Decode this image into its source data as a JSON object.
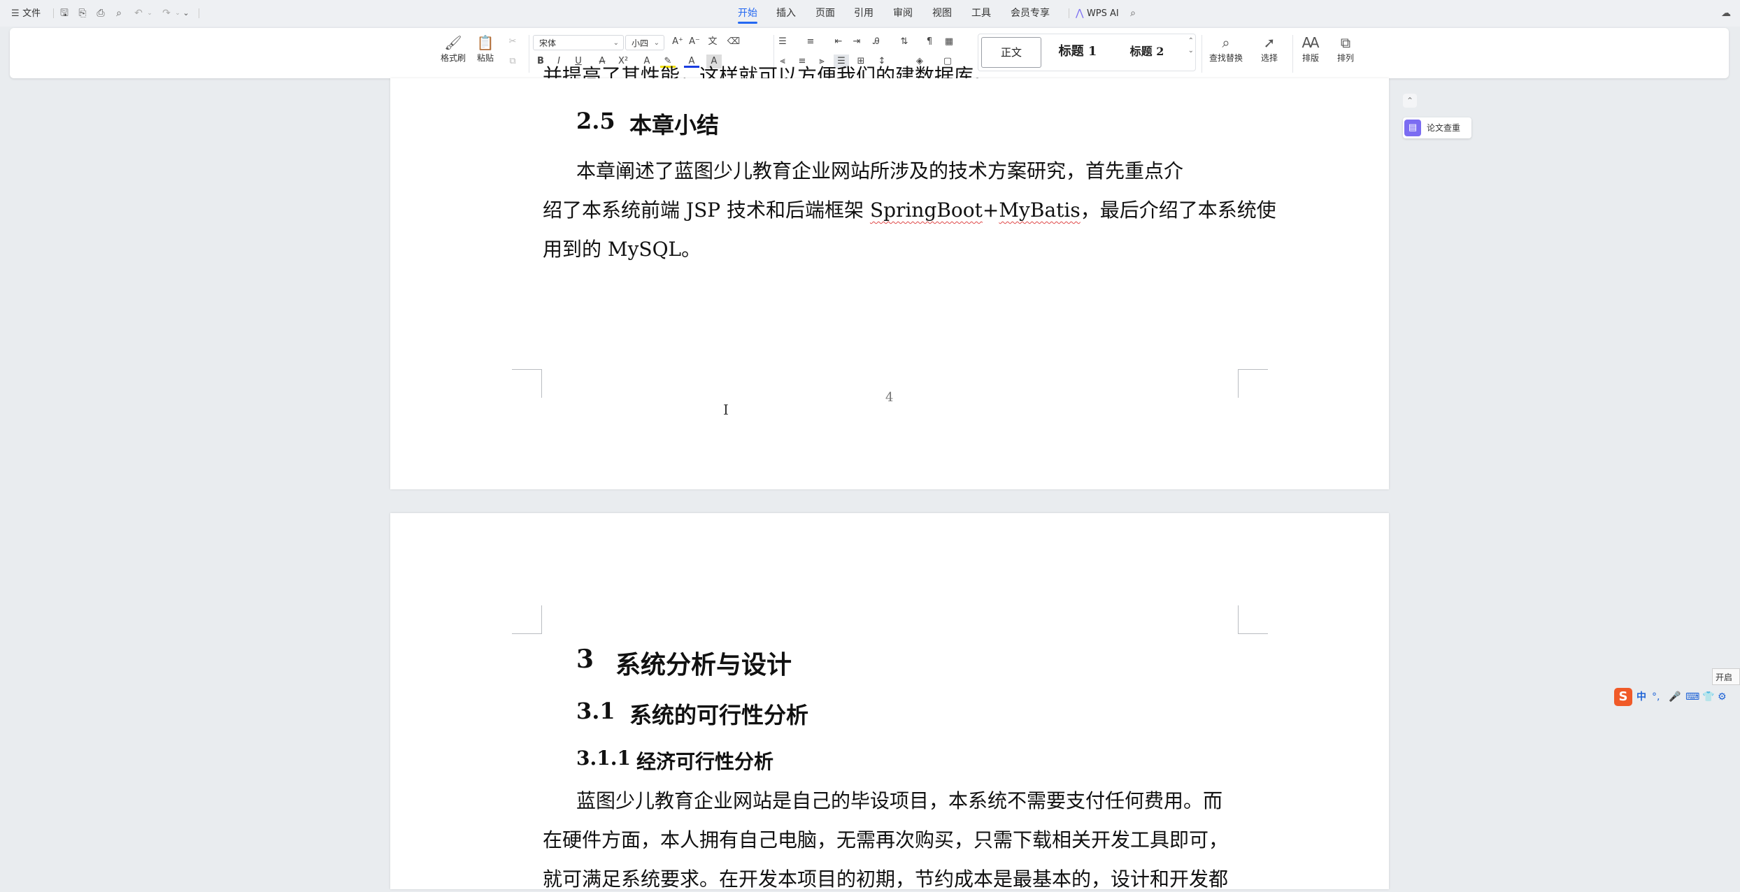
{
  "topbar": {
    "file_label": "文件",
    "tabs": [
      {
        "label": "开始",
        "active": true
      },
      {
        "label": "插入"
      },
      {
        "label": "页面"
      },
      {
        "label": "引用"
      },
      {
        "label": "审阅"
      },
      {
        "label": "视图"
      },
      {
        "label": "工具"
      },
      {
        "label": "会员专享"
      }
    ],
    "wps_ai": "WPS AI"
  },
  "ribbon": {
    "format_painter": "格式刷",
    "paste": "粘贴",
    "font_name": "宋体",
    "font_size": "小四",
    "styles": {
      "normal": "正文",
      "heading1": "标题 1",
      "heading2": "标题 2"
    },
    "find_replace": "查找替换",
    "select": "选择",
    "layout": "排版",
    "arrange": "排列"
  },
  "page1": {
    "cut_line": "并提高了其性能，这样就可以方便我们的建数据库。",
    "section_number": "2.5",
    "section_title": "本章小结",
    "para_line1": "本章阐述了蓝图少儿教育企业网站所涉及的技术方案研究，首先重点介",
    "para_line2_a": "绍了本系统前端 JSP 技术和后端框架 ",
    "para_line2_b": "SpringBoot",
    "para_line2_c": "+",
    "para_line2_d": "MyBatis",
    "para_line2_e": "，最后介绍了本系统使",
    "para_line3": "用到的 MySQL。",
    "page_number": "4"
  },
  "page2": {
    "chapter_number": "3",
    "chapter_title": "系统分析与设计",
    "section_number": "3.1",
    "section_title": "系统的可行性分析",
    "subsection_number": "3.1.1",
    "subsection_title": "经济可行性分析",
    "para_line1": "蓝图少儿教育企业网站是自己的毕设项目，本系统不需要支付任何费用。而",
    "para_line2": "在硬件方面，本人拥有自己电脑，无需再次购买，只需下载相关开发工具即可，",
    "para_line3": "就可满足系统要求。在开发本项目的初期，节约成本是最基本的，设计和开发都"
  },
  "side_panel": {
    "paper_check": "论文查重"
  },
  "ime": {
    "mode": "中",
    "tooltip": "开启"
  },
  "colors": {
    "accent": "#2468f2",
    "paper_check_icon": "#7b6cf2",
    "spell_underline": "#e04848",
    "ime_logo": "#f05a28"
  }
}
